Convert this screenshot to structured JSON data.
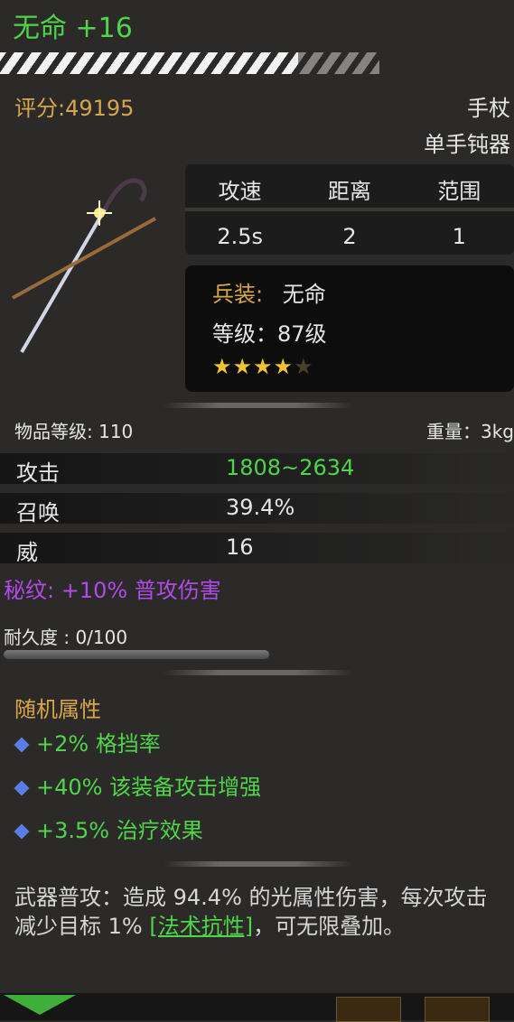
{
  "item": {
    "name": "无命 +16",
    "score": "评分:49195",
    "category": "手杖",
    "type": "单手钝器"
  },
  "stats_panel": {
    "headers": [
      "攻速",
      "距离",
      "范围"
    ],
    "values": [
      "2.5s",
      "2",
      "1"
    ]
  },
  "info_panel": {
    "weapon_label": "兵装:",
    "weapon_value": "无命",
    "level_text": "等级：87级",
    "stars_filled": 4,
    "stars_total": 5
  },
  "meta": {
    "item_level": "物品等级: 110",
    "weight": "重量：3kg"
  },
  "attributes": [
    {
      "label": "攻击",
      "value": "1808~2634"
    },
    {
      "label": "召唤",
      "value": "39.4%"
    },
    {
      "label": "威",
      "value": "16"
    }
  ],
  "secret": "秘纹: +10% 普攻伤害",
  "durability": {
    "text": "耐久度 : 0/100",
    "current": 0,
    "max": 100
  },
  "random_attrs": {
    "title": "随机属性",
    "items": [
      "+2% 格挡率",
      "+40% 该装备攻击增强",
      "+3.5% 治疗效果"
    ]
  },
  "description": {
    "prefix": "武器普攻：造成 94.4% 的光属性伤害，每次攻击减少目标 1% ",
    "link": "[法术抗性]",
    "suffix": "，可无限叠加。"
  },
  "colors": {
    "green": "#4fd44a",
    "gold": "#d8a64a",
    "purple": "#b04ae8",
    "star": "#f1c232"
  }
}
